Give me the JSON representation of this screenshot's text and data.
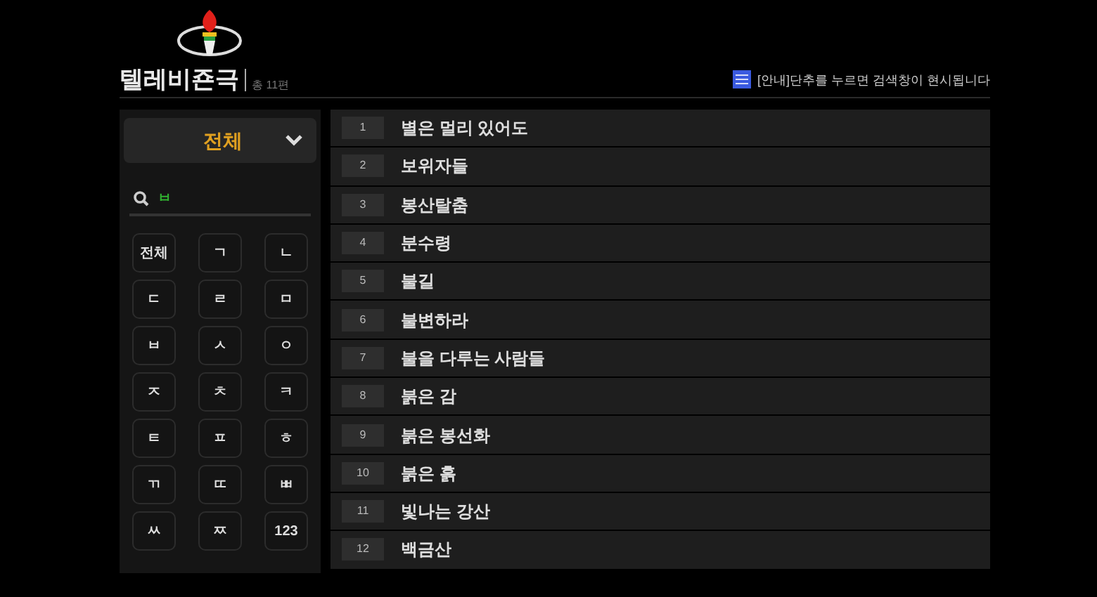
{
  "header": {
    "title": "텔레비죤극",
    "count": "총 11편",
    "notice": "[안내]단추를 누르면 검색창이 현시됩니다"
  },
  "filter": {
    "label": "전체",
    "expanded": false
  },
  "search": {
    "value": "ㅂ"
  },
  "keys": [
    {
      "label": "전체",
      "selected": false
    },
    {
      "label": "ㄱ",
      "selected": false
    },
    {
      "label": "ㄴ",
      "selected": false
    },
    {
      "label": "ㄷ",
      "selected": false
    },
    {
      "label": "ㄹ",
      "selected": false
    },
    {
      "label": "ㅁ",
      "selected": false
    },
    {
      "label": "ㅂ",
      "selected": false
    },
    {
      "label": "ㅅ",
      "selected": false
    },
    {
      "label": "ㅇ",
      "selected": false
    },
    {
      "label": "ㅈ",
      "selected": false
    },
    {
      "label": "ㅊ",
      "selected": false
    },
    {
      "label": "ㅋ",
      "selected": false
    },
    {
      "label": "ㅌ",
      "selected": false
    },
    {
      "label": "ㅍ",
      "selected": false
    },
    {
      "label": "ㅎ",
      "selected": false
    },
    {
      "label": "ㄲ",
      "selected": false
    },
    {
      "label": "ㄸ",
      "selected": false
    },
    {
      "label": "ㅃ",
      "selected": false
    },
    {
      "label": "ㅆ",
      "selected": false
    },
    {
      "label": "ㅉ",
      "selected": false
    },
    {
      "label": "123",
      "selected": false
    }
  ],
  "list": [
    {
      "number": "1",
      "title": "별은 멀리 있어도"
    },
    {
      "number": "2",
      "title": "보위자들"
    },
    {
      "number": "3",
      "title": "봉산탈춤"
    },
    {
      "number": "4",
      "title": "분수령"
    },
    {
      "number": "5",
      "title": "불길"
    },
    {
      "number": "6",
      "title": "불변하라"
    },
    {
      "number": "7",
      "title": "불을 다루는 사람들"
    },
    {
      "number": "8",
      "title": "붉은 감"
    },
    {
      "number": "9",
      "title": "붉은 봉선화"
    },
    {
      "number": "10",
      "title": "붉은 흙"
    },
    {
      "number": "11",
      "title": "빛나는 강산"
    },
    {
      "number": "12",
      "title": "백금산"
    }
  ]
}
